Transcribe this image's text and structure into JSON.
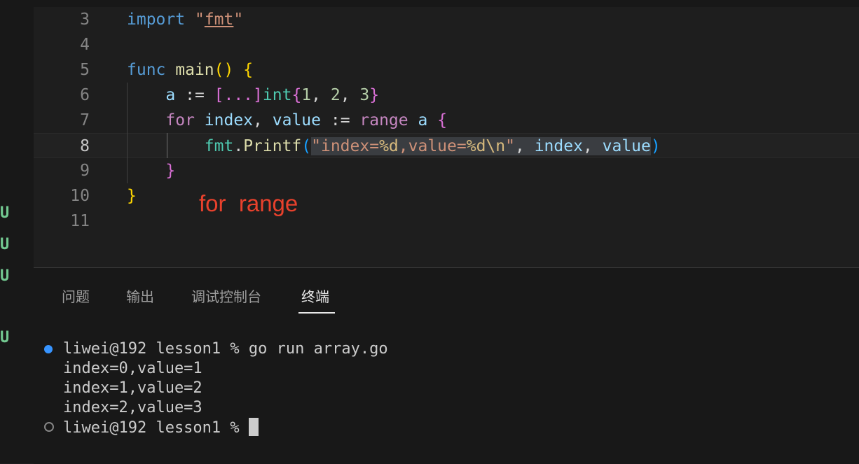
{
  "editor": {
    "lines": [
      {
        "number": "3",
        "tokens": [
          {
            "text": "import",
            "cls": "k"
          },
          {
            "text": " ",
            "cls": "w"
          },
          {
            "text": "\"",
            "cls": "s"
          },
          {
            "text": "fmt",
            "cls": "s uline"
          },
          {
            "text": "\"",
            "cls": "s"
          }
        ]
      },
      {
        "number": "4",
        "tokens": []
      },
      {
        "number": "5",
        "tokens": [
          {
            "text": "func",
            "cls": "k"
          },
          {
            "text": " ",
            "cls": "w"
          },
          {
            "text": "main",
            "cls": "f"
          },
          {
            "text": "()",
            "cls": "y"
          },
          {
            "text": " ",
            "cls": "w"
          },
          {
            "text": "{",
            "cls": "y"
          }
        ]
      },
      {
        "number": "6",
        "tokens": [
          {
            "text": "    ",
            "cls": "w"
          },
          {
            "text": "a",
            "cls": "v"
          },
          {
            "text": " := ",
            "cls": "w"
          },
          {
            "text": "[...]",
            "cls": "p"
          },
          {
            "text": "int",
            "cls": "t"
          },
          {
            "text": "{",
            "cls": "p"
          },
          {
            "text": "1",
            "cls": "n"
          },
          {
            "text": ", ",
            "cls": "w"
          },
          {
            "text": "2",
            "cls": "n"
          },
          {
            "text": ", ",
            "cls": "w"
          },
          {
            "text": "3",
            "cls": "n"
          },
          {
            "text": "}",
            "cls": "p"
          }
        ]
      },
      {
        "number": "7",
        "tokens": [
          {
            "text": "    ",
            "cls": "w"
          },
          {
            "text": "for",
            "cls": "c"
          },
          {
            "text": " ",
            "cls": "w"
          },
          {
            "text": "index",
            "cls": "v"
          },
          {
            "text": ", ",
            "cls": "w"
          },
          {
            "text": "value",
            "cls": "v"
          },
          {
            "text": " := ",
            "cls": "w"
          },
          {
            "text": "range",
            "cls": "c"
          },
          {
            "text": " ",
            "cls": "w"
          },
          {
            "text": "a",
            "cls": "v"
          },
          {
            "text": " ",
            "cls": "w"
          },
          {
            "text": "{",
            "cls": "p"
          }
        ]
      },
      {
        "number": "8",
        "tokens": [
          {
            "text": "        ",
            "cls": "w"
          },
          {
            "text": "fmt",
            "cls": "t"
          },
          {
            "text": ".",
            "cls": "w"
          },
          {
            "text": "Printf",
            "cls": "f"
          },
          {
            "text": "(",
            "cls": "b"
          },
          {
            "text": "\"index=",
            "cls": "s sel"
          },
          {
            "text": "%d",
            "cls": "e sel"
          },
          {
            "text": ",value=",
            "cls": "s sel"
          },
          {
            "text": "%d",
            "cls": "e sel"
          },
          {
            "text": "\\n",
            "cls": "e sel"
          },
          {
            "text": "\"",
            "cls": "s sel"
          },
          {
            "text": ", ",
            "cls": "w sel"
          },
          {
            "text": "index",
            "cls": "v sel"
          },
          {
            "text": ", ",
            "cls": "w sel"
          },
          {
            "text": "value",
            "cls": "v sel"
          },
          {
            "text": ")",
            "cls": "b"
          }
        ]
      },
      {
        "number": "9",
        "tokens": [
          {
            "text": "    ",
            "cls": "w"
          },
          {
            "text": "}",
            "cls": "p"
          }
        ]
      },
      {
        "number": "10",
        "tokens": [
          {
            "text": "}",
            "cls": "y"
          }
        ]
      },
      {
        "number": "11",
        "tokens": []
      }
    ],
    "annotation": "for  range"
  },
  "scm": {
    "marks": [
      "U",
      "U",
      "U",
      "U"
    ]
  },
  "panel": {
    "tabs": [
      "问题",
      "输出",
      "调试控制台",
      "终端"
    ],
    "active_tab": "终端",
    "terminal": {
      "command_prompt": "liwei@192 lesson1 % go run array.go",
      "output": [
        "index=0,value=1",
        "index=1,value=2",
        "index=2,value=3"
      ],
      "current_prompt": "liwei@192 lesson1 % "
    }
  }
}
